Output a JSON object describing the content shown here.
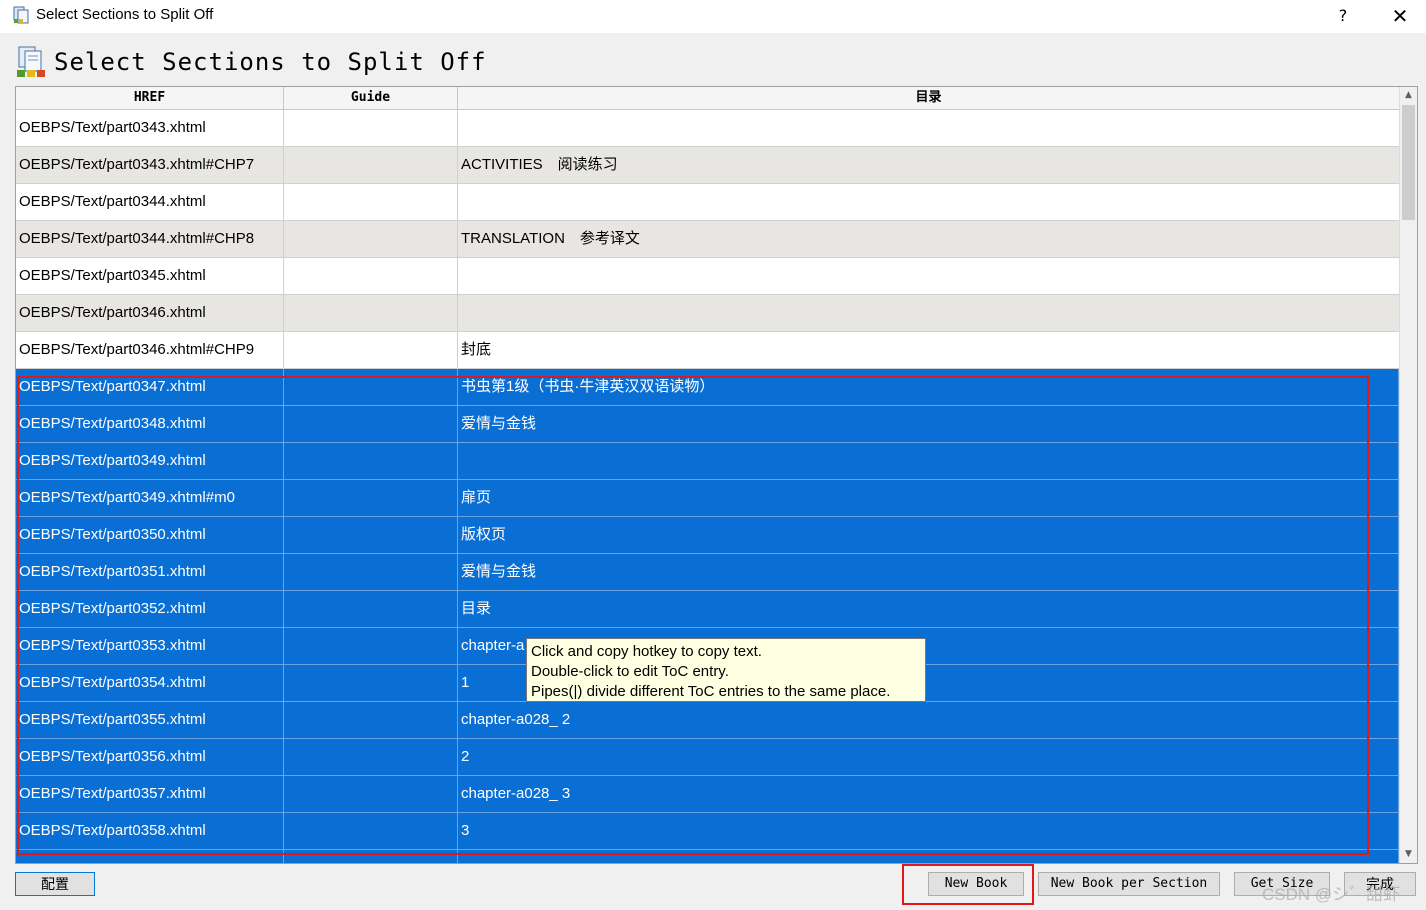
{
  "window": {
    "title": "Select Sections to Split Off",
    "help_label": "?",
    "close_label": "✕"
  },
  "header": {
    "heading": "Select Sections to Split Off"
  },
  "table": {
    "columns": [
      "HREF",
      "Guide",
      "目录"
    ],
    "rows": [
      {
        "href": "OEBPS/Text/part0343.xhtml",
        "guide": "",
        "toc": "",
        "style": "normal"
      },
      {
        "href": "OEBPS/Text/part0343.xhtml#CHP7",
        "guide": "",
        "toc": "ACTIVITIES　阅读练习",
        "style": "alt"
      },
      {
        "href": "OEBPS/Text/part0344.xhtml",
        "guide": "",
        "toc": "",
        "style": "normal"
      },
      {
        "href": "OEBPS/Text/part0344.xhtml#CHP8",
        "guide": "",
        "toc": "TRANSLATION　参考译文",
        "style": "alt"
      },
      {
        "href": "OEBPS/Text/part0345.xhtml",
        "guide": "",
        "toc": "",
        "style": "normal"
      },
      {
        "href": "OEBPS/Text/part0346.xhtml",
        "guide": "",
        "toc": "",
        "style": "alt"
      },
      {
        "href": "OEBPS/Text/part0346.xhtml#CHP9",
        "guide": "",
        "toc": "封底",
        "style": "normal"
      },
      {
        "href": "OEBPS/Text/part0347.xhtml",
        "guide": "",
        "toc": "书虫第1级（书虫·牛津英汉双语读物）",
        "style": "selected"
      },
      {
        "href": "OEBPS/Text/part0348.xhtml",
        "guide": "",
        "toc": "爱情与金钱",
        "style": "selected"
      },
      {
        "href": "OEBPS/Text/part0349.xhtml",
        "guide": "",
        "toc": "",
        "style": "selected"
      },
      {
        "href": "OEBPS/Text/part0349.xhtml#m0",
        "guide": "",
        "toc": "扉页",
        "style": "selected"
      },
      {
        "href": "OEBPS/Text/part0350.xhtml",
        "guide": "",
        "toc": "版权页",
        "style": "selected"
      },
      {
        "href": "OEBPS/Text/part0351.xhtml",
        "guide": "",
        "toc": "爱情与金钱",
        "style": "selected"
      },
      {
        "href": "OEBPS/Text/part0352.xhtml",
        "guide": "",
        "toc": "目录",
        "style": "selected"
      },
      {
        "href": "OEBPS/Text/part0353.xhtml",
        "guide": "",
        "toc": "chapter-a",
        "style": "selected"
      },
      {
        "href": "OEBPS/Text/part0354.xhtml",
        "guide": "",
        "toc": "1",
        "style": "selected"
      },
      {
        "href": "OEBPS/Text/part0355.xhtml",
        "guide": "",
        "toc": "chapter-a028_ 2",
        "style": "selected"
      },
      {
        "href": "OEBPS/Text/part0356.xhtml",
        "guide": "",
        "toc": "2",
        "style": "selected"
      },
      {
        "href": "OEBPS/Text/part0357.xhtml",
        "guide": "",
        "toc": "chapter-a028_ 3",
        "style": "selected"
      },
      {
        "href": "OEBPS/Text/part0358.xhtml",
        "guide": "",
        "toc": "3",
        "style": "selected"
      },
      {
        "href": "",
        "guide": "",
        "toc": "",
        "style": "selected"
      }
    ]
  },
  "tooltip": {
    "line1": "Click and copy hotkey to copy text.",
    "line2": "Double-click to edit ToC entry.",
    "line3": "Pipes(|) divide different ToC entries to the same place."
  },
  "buttons": {
    "config": "配置",
    "new_book": "New Book",
    "new_book_per_section": "New Book per Section",
    "get_size": "Get Size",
    "done": "完成"
  },
  "watermark": "CSDN @シ゛甜虾",
  "colors": {
    "selection": "#0a6fd4",
    "highlight_box": "#e01818",
    "tooltip_bg": "#ffffe1"
  }
}
